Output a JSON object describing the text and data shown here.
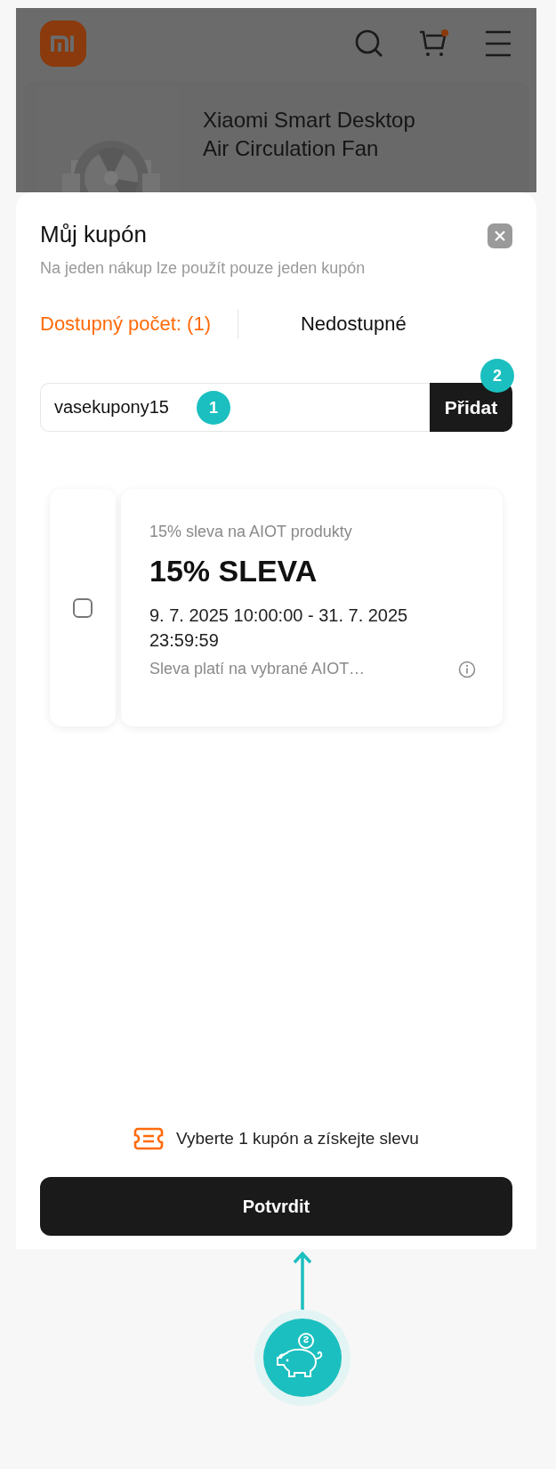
{
  "product": {
    "title": "Xiaomi Smart Desktop Air Circulation Fan"
  },
  "sheet": {
    "title": "Můj kupón",
    "subtitle": "Na jeden nákup lze použít pouze jeden kupón",
    "tabs": [
      {
        "label": "Dostupný počet: (1)",
        "selected": true
      },
      {
        "label": "Nedostupné",
        "selected": false
      }
    ],
    "code_field": {
      "value": "vasekupony15"
    },
    "add_button": "Přidat",
    "coupons": [
      {
        "checked": false,
        "caption": "15% sleva na AIOT produkty",
        "title": "15% SLEVA",
        "validity": "9. 7. 2025 10:00:00 - 31. 7. 2025 23:59:59",
        "note": "Sleva platí na vybrané AIOT…"
      }
    ],
    "hint": "Vyberte 1 kupón a získejte slevu",
    "confirm_button": "Potvrdit"
  },
  "annotations": [
    {
      "label": "1"
    },
    {
      "label": "2"
    }
  ]
}
